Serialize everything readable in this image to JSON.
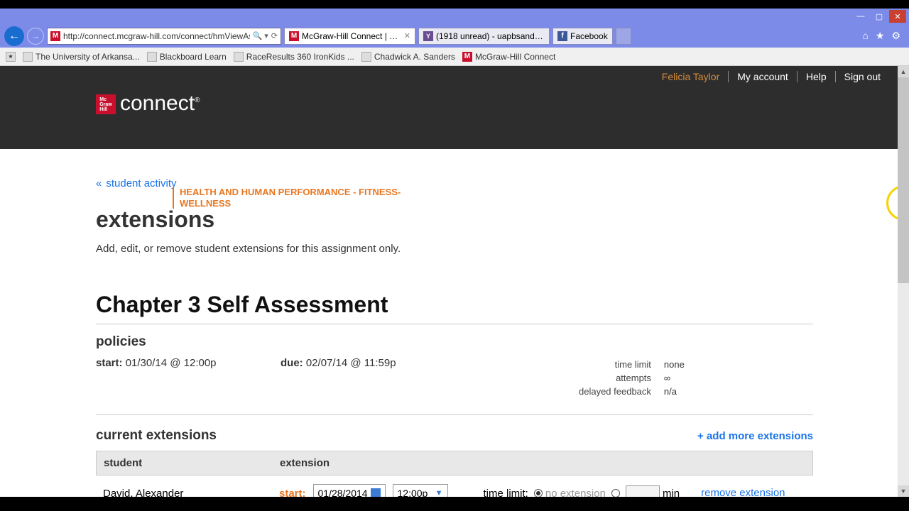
{
  "window": {
    "url": "http://connect.mcgraw-hill.com/connect/hmViewAss"
  },
  "tabs": [
    {
      "label": "McGraw-Hill Connect | Edit ...",
      "icon": "m"
    },
    {
      "label": "(1918 unread) - uapbsanders - ...",
      "icon": "y"
    },
    {
      "label": "Facebook",
      "icon": "f"
    }
  ],
  "bookmarks": [
    "The University of Arkansa...",
    "Blackboard Learn",
    "RaceResults 360 IronKids ...",
    "Chadwick A. Sanders",
    "McGraw-Hill Connect"
  ],
  "topnav": {
    "user": "Felicia Taylor",
    "account": "My account",
    "help": "Help",
    "signout": "Sign out"
  },
  "brand": {
    "logo": "connect",
    "subtitle": "HEALTH AND HUMAN PERFORMANCE - FITNESS-WELLNESS"
  },
  "breadcrumb": {
    "back": "student activity"
  },
  "page": {
    "title": "extensions",
    "desc": "Add, edit, or remove student extensions for this assignment only.",
    "assignment": "Chapter 3 Self Assessment"
  },
  "policies": {
    "heading": "policies",
    "start_label": "start:",
    "start_value": "01/30/14 @ 12:00p",
    "due_label": "due:",
    "due_value": "02/07/14 @ 11:59p",
    "time_limit_k": "time limit",
    "time_limit_v": "none",
    "attempts_k": "attempts",
    "attempts_v": "∞",
    "delayed_k": "delayed feedback",
    "delayed_v": "n/a"
  },
  "extensions": {
    "heading": "current extensions",
    "add_more": "+ add more extensions",
    "th_student": "student",
    "th_ext": "extension",
    "row": {
      "student": "David, Alexander",
      "start_label": "start:",
      "date": "01/28/2014",
      "time": "12:00p",
      "tl_label": "time limit:",
      "noext": "no extension",
      "min": "min",
      "remove": "remove extension"
    }
  }
}
